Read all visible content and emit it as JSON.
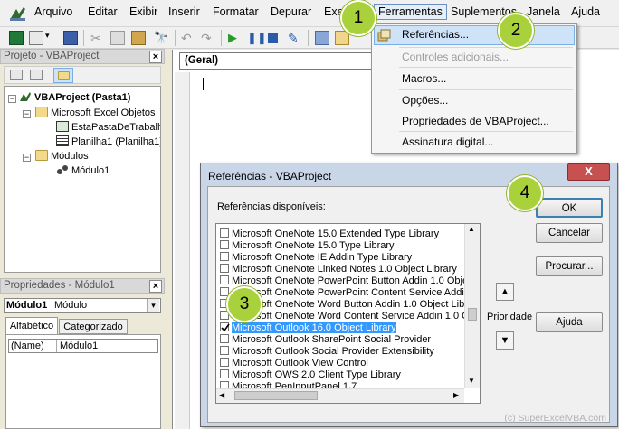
{
  "menubar": {
    "items": [
      "Arquivo",
      "Editar",
      "Exibir",
      "Inserir",
      "Formatar",
      "Depurar",
      "Exe",
      "Ferramentas",
      "Suplementos",
      "Janela",
      "Ajuda"
    ]
  },
  "project_panel": {
    "title": "Projeto - VBAProject",
    "tree": {
      "root": "VBAProject (Pasta1)",
      "excel_objects_folder": "Microsoft Excel Objetos",
      "this_workbook": "EstaPastaDeTrabalho",
      "sheet1": "Planilha1 (Planilha1)",
      "modules_folder": "Módulos",
      "module1": "Módulo1"
    }
  },
  "properties_panel": {
    "title": "Propriedades - Módulo1",
    "object_name": "Módulo1",
    "object_type": "Módulo",
    "tabs": [
      "Alfabético",
      "Categorizado"
    ],
    "rows": [
      {
        "name": "(Name)",
        "value": "Módulo1"
      }
    ]
  },
  "code_window": {
    "object_combo": "(Geral)"
  },
  "tools_menu": {
    "items": [
      {
        "label": "Referências...",
        "enabled": true,
        "highlighted": true
      },
      {
        "label": "Controles adicionais...",
        "enabled": false
      },
      {
        "label": "Macros...",
        "enabled": true
      },
      {
        "label": "Opções...",
        "enabled": true
      },
      {
        "label": "Propriedades de VBAProject...",
        "enabled": true
      },
      {
        "label": "Assinatura digital...",
        "enabled": true
      }
    ]
  },
  "dialog": {
    "title": "Referências - VBAProject",
    "close_label": "X",
    "list_label": "Referências disponíveis:",
    "references": [
      {
        "name": "Microsoft OneNote 15.0 Extended Type Library",
        "checked": false
      },
      {
        "name": "Microsoft OneNote 15.0 Type Library",
        "checked": false
      },
      {
        "name": "Microsoft OneNote IE Addin Type Library",
        "checked": false
      },
      {
        "name": "Microsoft OneNote Linked Notes 1.0 Object Library",
        "checked": false
      },
      {
        "name": "Microsoft OneNote PowerPoint Button Addin 1.0 Obje",
        "checked": false
      },
      {
        "name": "Microsoft OneNote PowerPoint Content Service Addin",
        "checked": false
      },
      {
        "name": "Microsoft OneNote Word Button Addin 1.0 Object Lib",
        "checked": false
      },
      {
        "name": "Microsoft OneNote Word Content Service Addin 1.0 O",
        "checked": false
      },
      {
        "name": "Microsoft Outlook 16.0 Object Library",
        "checked": true,
        "selected": true
      },
      {
        "name": "Microsoft Outlook SharePoint Social Provider",
        "checked": false
      },
      {
        "name": "Microsoft Outlook Social Provider Extensibility",
        "checked": false
      },
      {
        "name": "Microsoft Outlook View Control",
        "checked": false
      },
      {
        "name": "Microsoft OWS 2.0 Client Type Library",
        "checked": false
      },
      {
        "name": "Microsoft PenInputPanel 1.7",
        "checked": false
      }
    ],
    "buttons": {
      "ok": "OK",
      "cancel": "Cancelar",
      "browse": "Procurar...",
      "help": "Ajuda"
    },
    "priority_label": "Prioridade",
    "priority_up": "▲",
    "priority_down": "▼"
  },
  "callouts": [
    "1",
    "2",
    "3",
    "4"
  ],
  "watermark": "(c) SuperExcelVBA.com",
  "colors": {
    "callout": "#a9d13b",
    "selection": "#3399ff",
    "menu_highlight": "#cfe3f8"
  }
}
